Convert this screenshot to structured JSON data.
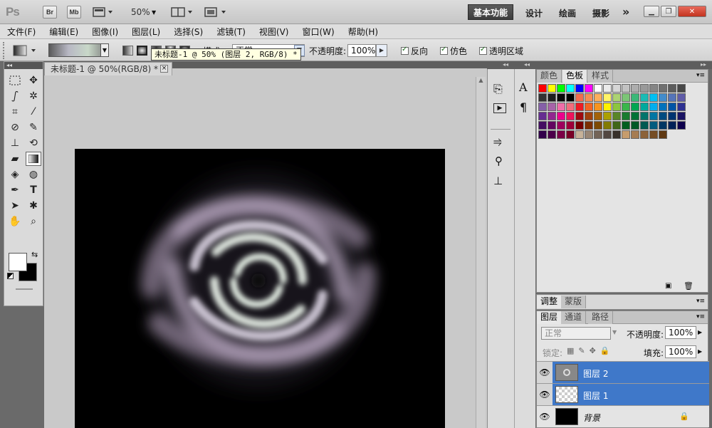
{
  "app": {
    "logo": "Ps",
    "bridge_label": "Br",
    "minibridge_label": "Mb",
    "zoom": "50%",
    "workspaces": [
      "基本功能",
      "设计",
      "绘画",
      "摄影"
    ],
    "more": "»"
  },
  "menu": [
    "文件(F)",
    "编辑(E)",
    "图像(I)",
    "图层(L)",
    "选择(S)",
    "滤镜(T)",
    "视图(V)",
    "窗口(W)",
    "帮助(H)"
  ],
  "options": {
    "mode_label": "模式",
    "mode_value": "正常",
    "opacity_label": "不透明度:",
    "opacity_value": "100%",
    "reverse_label": "反向",
    "dither_label": "仿色",
    "transparency_label": "透明区域",
    "tooltip": "未标题-1 @ 50% (图层 2, RGB/8) *"
  },
  "document": {
    "tab_title": "未标题-1 @ 50%(RGB/8) *",
    "close": "×"
  },
  "swatch_panel": {
    "tabs": [
      "颜色",
      "色板",
      "样式"
    ],
    "active_tab": "色板",
    "colors": [
      "#ff0000",
      "#ffff00",
      "#00ff00",
      "#00ffff",
      "#0000ff",
      "#ff00ff",
      "#ffffff",
      "#ebebeb",
      "#d6d6d6",
      "#c2c2c2",
      "#adadad",
      "#999999",
      "#858585",
      "#707070",
      "#5c5c5c",
      "#474747",
      "#333333",
      "#1f1f1f",
      "#0a0a0a",
      "#000000",
      "#f26c4f",
      "#f68e55",
      "#fbaf5c",
      "#fff467",
      "#acd372",
      "#7cc576",
      "#3bb878",
      "#1abbb4",
      "#00bff3",
      "#438ccb",
      "#5574b9",
      "#605ca8",
      "#855fa8",
      "#a763a8",
      "#f06ea9",
      "#f26d7d",
      "#ed1c24",
      "#f26522",
      "#f7941d",
      "#fff200",
      "#8dc63f",
      "#39b54a",
      "#00a651",
      "#00a99d",
      "#00aeef",
      "#0072bc",
      "#0054a6",
      "#2e3192",
      "#662d91",
      "#92278f",
      "#ec008c",
      "#ed145b",
      "#9e0b0f",
      "#a0410d",
      "#a36209",
      "#aba000",
      "#598527",
      "#197b30",
      "#007236",
      "#00746b",
      "#0076a3",
      "#004b80",
      "#003471",
      "#1b1464",
      "#440e62",
      "#630460",
      "#9e005d",
      "#9e0039",
      "#790000",
      "#7b2e00",
      "#7d4900",
      "#827b00",
      "#406618",
      "#005e20",
      "#005826",
      "#005952",
      "#005b7f",
      "#003663",
      "#002157",
      "#0d004c",
      "#32004b",
      "#4b0049",
      "#7b0046",
      "#7a0026",
      "#c7b299",
      "#998675",
      "#736357",
      "#534741",
      "#37302a",
      "#c69c6d",
      "#a67c52",
      "#8c6239",
      "#754c24",
      "#603913"
    ]
  },
  "adj_panel": {
    "tabs": [
      "调整",
      "蒙版"
    ]
  },
  "layers_panel": {
    "tabs": [
      "图层",
      "通道",
      "路径"
    ],
    "blend_mode": "正常",
    "opacity_label": "不透明度:",
    "opacity_value": "100%",
    "lock_label": "锁定:",
    "fill_label": "填充:",
    "fill_value": "100%",
    "layers": [
      {
        "name": "图层 2",
        "selected": true
      },
      {
        "name": "图层 1",
        "selected": true
      },
      {
        "name": "背景",
        "selected": false,
        "locked": true
      }
    ]
  },
  "colors": {
    "accent": "#3f78c9",
    "canvas": "#000000",
    "workspace_active": "#4a4a4a"
  }
}
